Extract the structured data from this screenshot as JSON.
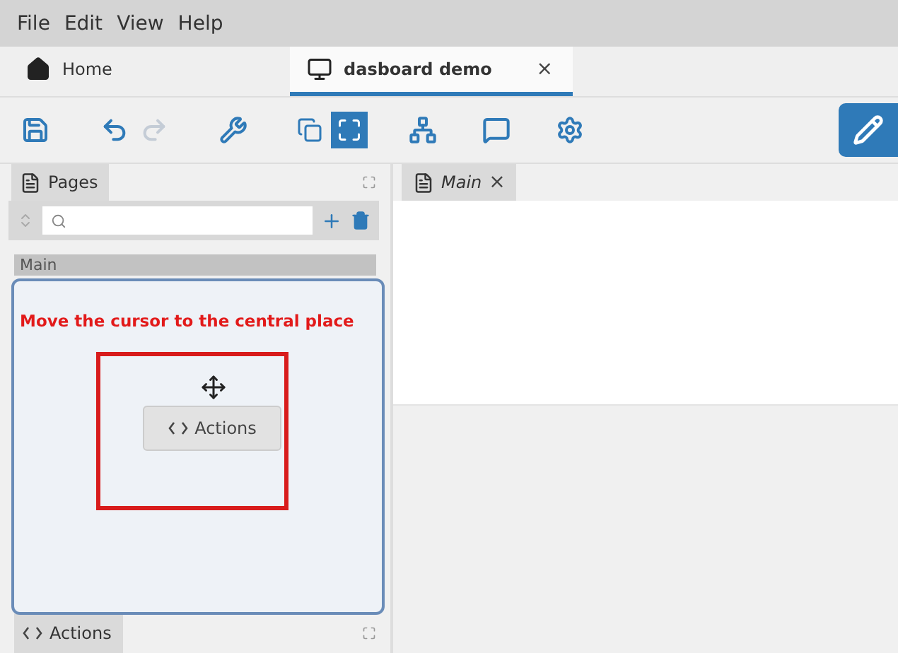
{
  "menu": [
    "File",
    "Edit",
    "View",
    "Help"
  ],
  "tabs": [
    {
      "label": "Home",
      "kind": "home",
      "selected": false
    },
    {
      "label": "dasboard demo",
      "kind": "dashboard",
      "selected": true,
      "close": "×"
    }
  ],
  "toolbar": [
    {
      "kind": "save",
      "disabled": false
    },
    {
      "kind": "undo",
      "disabled": false
    },
    {
      "kind": "redo",
      "disabled": true
    },
    {
      "kind": "wrench",
      "disabled": false
    },
    {
      "kind": "settings",
      "disabled": false
    }
  ],
  "view_modes": [
    {
      "kind": "select",
      "selected": false
    },
    {
      "kind": "frame",
      "selected": true
    }
  ],
  "pages_panel": {
    "title": "Pages",
    "items": [
      {
        "label": "Main",
        "selected": true
      }
    ]
  },
  "annotation": {
    "text": "Move the cursor to the central place",
    "chip": "Actions"
  },
  "editor_tab": {
    "label": "Main",
    "close": "×"
  },
  "bottom_panel": {
    "title": "Actions"
  }
}
